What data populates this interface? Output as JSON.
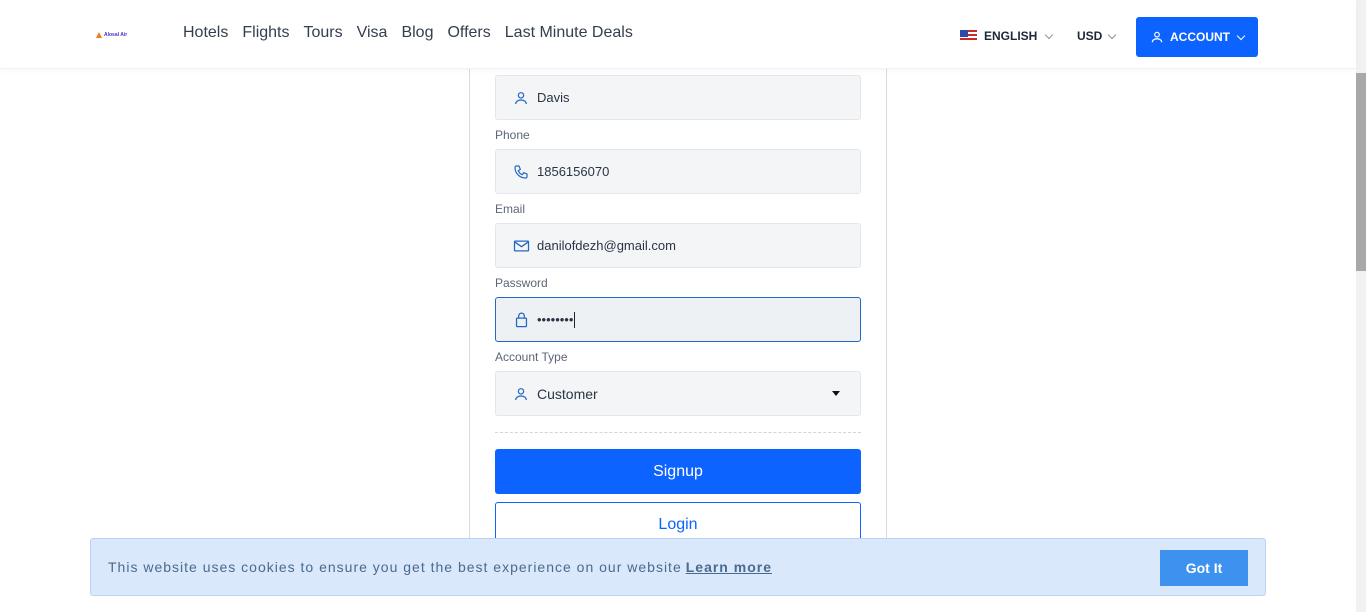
{
  "header": {
    "logo_text": "Alosal Air",
    "nav": [
      "Hotels",
      "Flights",
      "Tours",
      "Visa",
      "Blog",
      "Offers",
      "Last Minute Deals"
    ],
    "language": "ENGLISH",
    "currency": "USD",
    "account_label": "ACCOUNT"
  },
  "form": {
    "last_name_value": "Davis",
    "phone_label": "Phone",
    "phone_value": "1856156070",
    "email_label": "Email",
    "email_value": "danilofdezh@gmail.com",
    "password_label": "Password",
    "password_value": "••••••••",
    "account_type_label": "Account Type",
    "account_type_value": "Customer",
    "signup_label": "Signup",
    "login_label": "Login"
  },
  "cookie": {
    "message": "This website uses cookies to ensure you get the best experience on our website",
    "learn_more": "Learn more",
    "got_it": "Got It"
  },
  "colors": {
    "primary": "#0d63ff",
    "cookie_bg": "#d9e8fb",
    "cookie_button": "#3d92f0"
  }
}
